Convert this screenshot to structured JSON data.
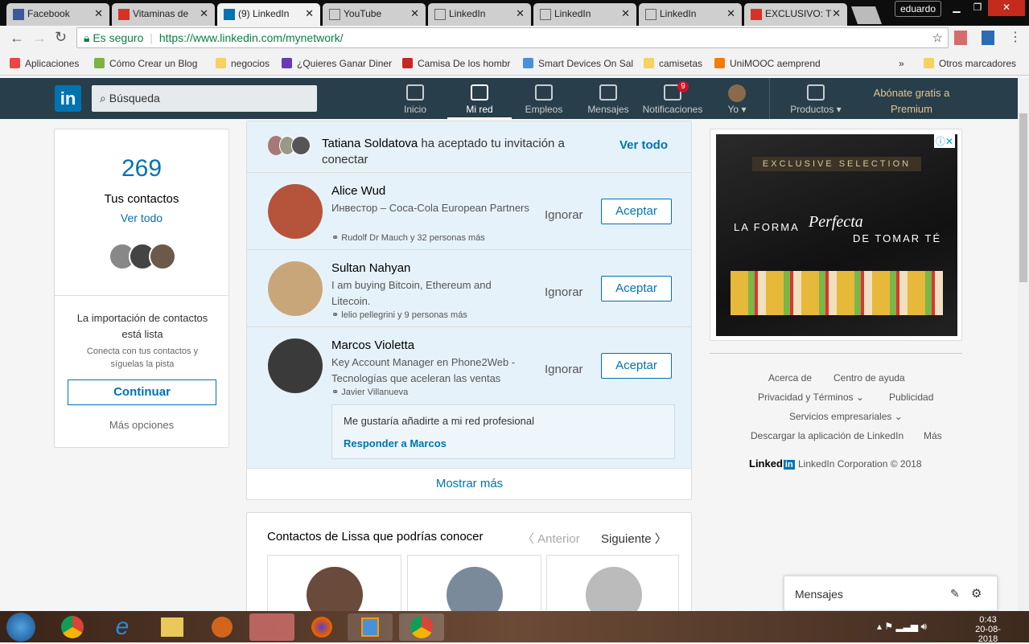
{
  "browser": {
    "tabs": [
      {
        "title": "Facebook",
        "icon": "facebook-icon",
        "color": "#3b5998"
      },
      {
        "title": "Vitaminas de",
        "icon": "gmail-icon",
        "color": "#d93025"
      },
      {
        "title": "(9) LinkedIn",
        "icon": "linkedin-icon",
        "color": "#0073b1",
        "active": true
      },
      {
        "title": "YouTube",
        "icon": "page-icon"
      },
      {
        "title": "LinkedIn",
        "icon": "page-icon"
      },
      {
        "title": "LinkedIn",
        "icon": "page-icon"
      },
      {
        "title": "LinkedIn",
        "icon": "page-icon"
      },
      {
        "title": "EXCLUSIVO: T",
        "icon": "gmail-icon",
        "color": "#d93025"
      }
    ],
    "user": "eduardo",
    "secure_label": "Es seguro",
    "url": "https://www.linkedin.com/mynetwork/",
    "bookmarks": [
      {
        "label": "Aplicaciones",
        "color": "#e44"
      },
      {
        "label": "Cómo Crear un Blog",
        "color": "#7cb342"
      },
      {
        "label": "negocios",
        "color": "#f4d35e"
      },
      {
        "label": "¿Quieres Ganar Diner",
        "color": "#673ab7"
      },
      {
        "label": "Camisa De los hombr",
        "color": "#c62828"
      },
      {
        "label": "Smart Devices On Sal",
        "color": "#4a90d9"
      },
      {
        "label": "camisetas",
        "color": "#f4d35e"
      },
      {
        "label": "UniMOOC aemprend",
        "color": "#f57c00"
      }
    ],
    "overflow": "»",
    "other_bookmarks": "Otros marcadores"
  },
  "linkedin": {
    "search_placeholder": "Búsqueda",
    "nav": [
      {
        "label": "Inicio"
      },
      {
        "label": "Mi red",
        "active": true
      },
      {
        "label": "Empleos"
      },
      {
        "label": "Mensajes"
      },
      {
        "label": "Notificaciones",
        "badge": "9"
      },
      {
        "label": "Yo ▾"
      },
      {
        "label": "Productos ▾"
      }
    ],
    "premium": "Abónate gratis a Premium",
    "left": {
      "count": "269",
      "count_label": "Tus contactos",
      "see_all": "Ver todo",
      "import_title": "La importación de contactos está lista",
      "import_sub": "Conecta con tus contactos y síguelas la pista",
      "continue": "Continuar",
      "more": "Más opciones"
    },
    "accepted": {
      "name": "Tatiana Soldatova",
      "text": " ha aceptado tu invitación a conectar",
      "see_all": "Ver todo"
    },
    "invites": [
      {
        "name": "Alice Wud",
        "headline": "Инвестор – Coca-Cola European Partners",
        "mutual": "Rudolf Dr Mauch y 32 personas más",
        "color": "#b5543a"
      },
      {
        "name": "Sultan Nahyan",
        "headline": "I am buying Bitcoin, Ethereum and Litecoin.",
        "mutual": "lelio pellegrini y 9 personas más",
        "color": "#c9a67a"
      },
      {
        "name": "Marcos Violetta",
        "headline": "Key Account Manager en Phone2Web - Tecnologías que aceleran las ventas",
        "mutual": "Javier Villanueva",
        "color": "#3a3a3a"
      }
    ],
    "ignore": "Ignorar",
    "accept": "Aceptar",
    "message": {
      "text": "Me gustaría añadirte a mi red profesional",
      "reply": "Responder a Marcos"
    },
    "show_more": "Mostrar más",
    "pymk": {
      "title": "Contactos de Lissa que podrías conocer",
      "prev": "〈 Anterior",
      "next": "Siguiente 〉"
    },
    "ad": {
      "tag": "EXCLUSIVE SELECTION",
      "line1": "LA FORMA",
      "script": "Perfecta",
      "line2": "DE TOMAR TÉ"
    },
    "footer": {
      "links": [
        "Acerca de",
        "Centro de ayuda",
        "Privacidad y Términos ⌄",
        "Publicidad",
        "Servicios empresariales ⌄",
        "Descargar la aplicación de LinkedIn",
        "Más"
      ],
      "brand": "Linked",
      "copyright": "LinkedIn Corporation © 2018"
    },
    "messaging": "Mensajes"
  },
  "taskbar": {
    "time": "0:43",
    "date": "20-08-2018"
  }
}
